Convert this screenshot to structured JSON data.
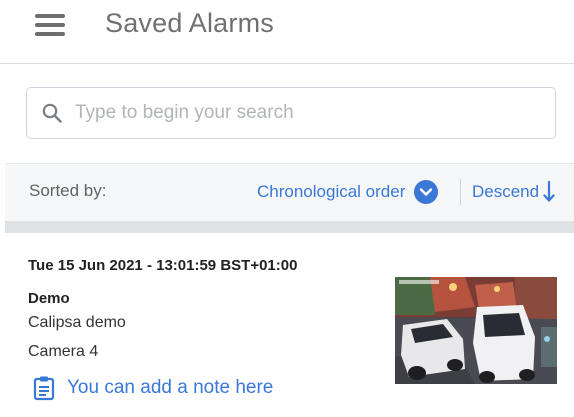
{
  "header": {
    "title": "Saved Alarms",
    "menu_icon": "hamburger-menu-icon"
  },
  "search": {
    "icon": "search-icon",
    "placeholder": "Type to begin your search",
    "value": ""
  },
  "sort": {
    "label": "Sorted by:",
    "order_label": "Chronological order",
    "order_icon": "chevron-down-circle-icon",
    "direction_label": "Descend",
    "direction_icon": "arrow-down-icon"
  },
  "alarms": [
    {
      "datetime": "Tue 15 Jun 2021 - 13:01:59 BST+01:00",
      "site": "Demo",
      "client": "Calipsa demo",
      "camera": "Camera 4",
      "note_label": "You can add a note here",
      "note_icon": "clipboard-icon",
      "thumbnail": "camera-snapshot-thumbnail"
    }
  ],
  "colors": {
    "accent": "#3a78d8",
    "title_text": "#707070",
    "sort_bar_bg": "#f6f7f8",
    "divider": "#dfe2e5"
  }
}
